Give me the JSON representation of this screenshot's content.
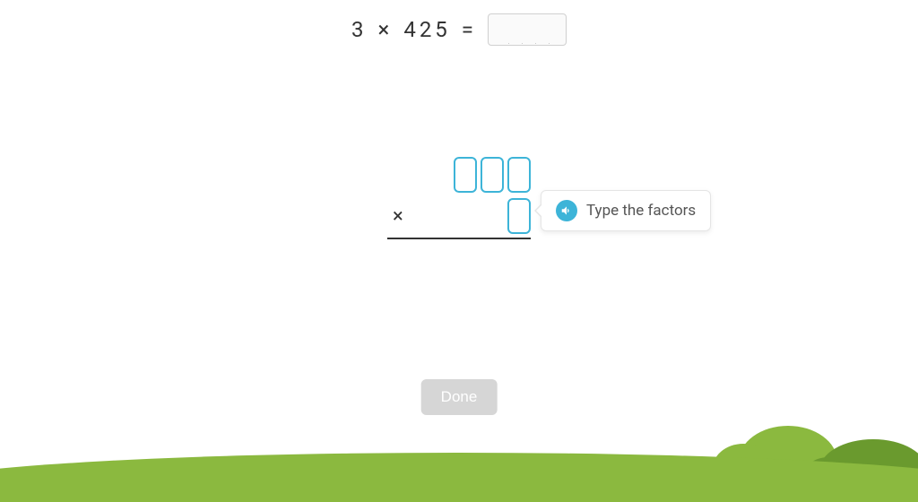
{
  "equation": {
    "factor1": "3",
    "operator": "×",
    "factor2": "425",
    "equals": "="
  },
  "workspace": {
    "operator": "×"
  },
  "tooltip": {
    "text": "Type the factors"
  },
  "button": {
    "done": "Done"
  }
}
